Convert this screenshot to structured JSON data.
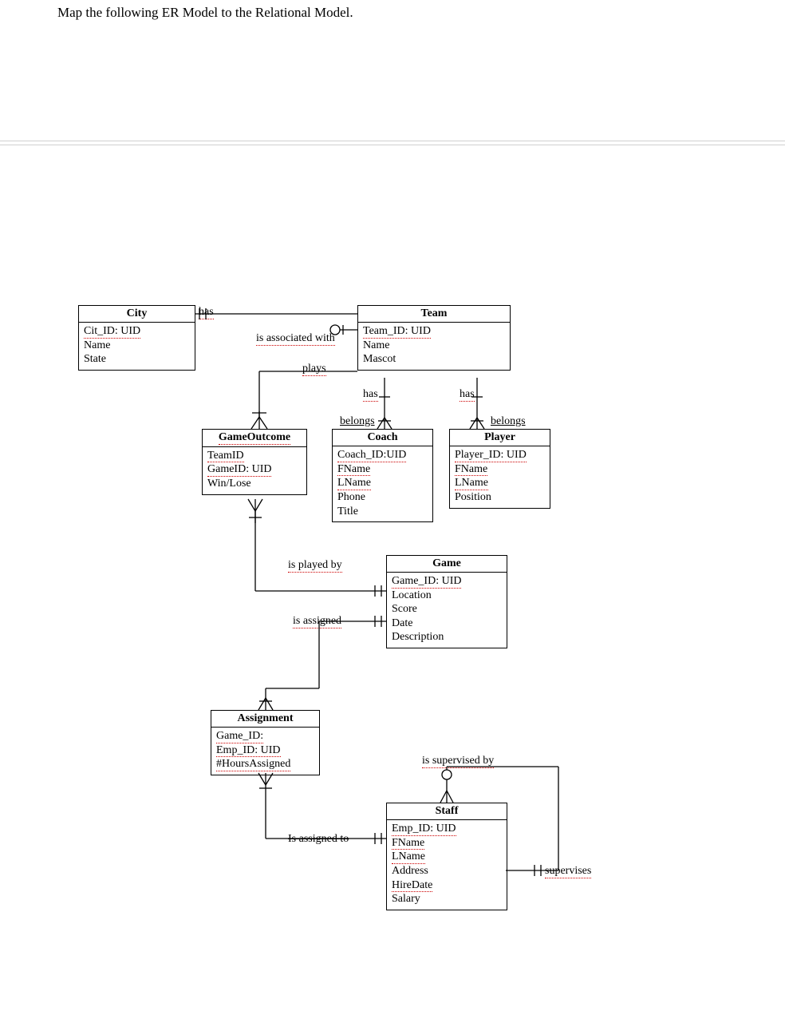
{
  "question": "Map the following ER Model to the Relational Model.",
  "entities": {
    "city": {
      "title": "City",
      "attrs": [
        "Cit_ID: UID",
        "Name",
        "State"
      ]
    },
    "team": {
      "title": "Team",
      "attrs": [
        "Team_ID: UID",
        "Name",
        "Mascot"
      ]
    },
    "gameOutcome": {
      "title": "GameOutcome",
      "attrs": [
        "TeamID",
        "GameID: UID",
        "Win/Lose"
      ]
    },
    "coach": {
      "title": "Coach",
      "attrs": [
        "Coach_ID:UID",
        "FName",
        "LName",
        "Phone",
        "Title"
      ]
    },
    "player": {
      "title": "Player",
      "attrs": [
        "Player_ID: UID",
        "FName",
        "LName",
        "Position"
      ]
    },
    "game": {
      "title": "Game",
      "attrs": [
        "Game_ID: UID",
        "Location",
        "Score",
        "Date",
        "Description"
      ]
    },
    "assignment": {
      "title": "Assignment",
      "attrs": [
        "Game_ID:",
        "Emp_ID: UID",
        "#HoursAssigned"
      ]
    },
    "staff": {
      "title": "Staff",
      "attrs": [
        "Emp_ID: UID",
        "FName",
        "LName",
        "Address",
        "HireDate",
        "Salary"
      ]
    }
  },
  "relationships": {
    "city_team_l": "has",
    "city_team_r": "is associated with",
    "team_go": "plays",
    "team_coach_l": "has",
    "team_coach_r": "belongs",
    "team_player_l": "has",
    "team_player_r": "belongs",
    "go_game": "is played by",
    "game_assign": "is assigned",
    "assign_staff": "Is assigned to",
    "staff_self_top": "is supervised by",
    "staff_self_side": "supervises"
  },
  "chart_data": {
    "type": "er-diagram",
    "entities": [
      {
        "name": "City",
        "pk": [
          "Cit_ID"
        ],
        "attributes": [
          "Cit_ID: UID",
          "Name",
          "State"
        ]
      },
      {
        "name": "Team",
        "pk": [
          "Team_ID"
        ],
        "attributes": [
          "Team_ID: UID",
          "Name",
          "Mascot"
        ]
      },
      {
        "name": "GameOutcome",
        "pk": [
          "TeamID",
          "GameID"
        ],
        "attributes": [
          "TeamID",
          "GameID: UID",
          "Win/Lose"
        ],
        "associative": true
      },
      {
        "name": "Coach",
        "pk": [
          "Coach_ID"
        ],
        "attributes": [
          "Coach_ID: UID",
          "FName",
          "LName",
          "Phone",
          "Title"
        ]
      },
      {
        "name": "Player",
        "pk": [
          "Player_ID"
        ],
        "attributes": [
          "Player_ID: UID",
          "FName",
          "LName",
          "Position"
        ]
      },
      {
        "name": "Game",
        "pk": [
          "Game_ID"
        ],
        "attributes": [
          "Game_ID: UID",
          "Location",
          "Score",
          "Date",
          "Description"
        ]
      },
      {
        "name": "Assignment",
        "pk": [
          "Game_ID",
          "Emp_ID"
        ],
        "attributes": [
          "Game_ID",
          "Emp_ID: UID",
          "#HoursAssigned"
        ],
        "associative": true
      },
      {
        "name": "Staff",
        "pk": [
          "Emp_ID"
        ],
        "attributes": [
          "Emp_ID: UID",
          "FName",
          "LName",
          "Address",
          "HireDate",
          "Salary"
        ]
      }
    ],
    "relationships": [
      {
        "from": "City",
        "to": "Team",
        "label_from": "has",
        "label_to": "is associated with",
        "card_from": "1",
        "card_to": "0..1"
      },
      {
        "from": "Team",
        "to": "GameOutcome",
        "label": "plays",
        "card_from": "1",
        "card_to": "0..*"
      },
      {
        "from": "Team",
        "to": "Coach",
        "label_from": "has",
        "label_to": "belongs",
        "card_from": "1",
        "card_to": "1..*"
      },
      {
        "from": "Team",
        "to": "Player",
        "label_from": "has",
        "label_to": "belongs",
        "card_from": "1",
        "card_to": "1..*"
      },
      {
        "from": "GameOutcome",
        "to": "Game",
        "label": "is played by",
        "card_from": "0..*",
        "card_to": "1"
      },
      {
        "from": "Game",
        "to": "Assignment",
        "label": "is assigned",
        "card_from": "1",
        "card_to": "0..*"
      },
      {
        "from": "Assignment",
        "to": "Staff",
        "label": "Is assigned to",
        "card_from": "0..*",
        "card_to": "1"
      },
      {
        "from": "Staff",
        "to": "Staff",
        "label_from": "is supervised by",
        "label_to": "supervises",
        "card_from": "0..*",
        "card_to": "0..1",
        "recursive": true
      }
    ]
  }
}
